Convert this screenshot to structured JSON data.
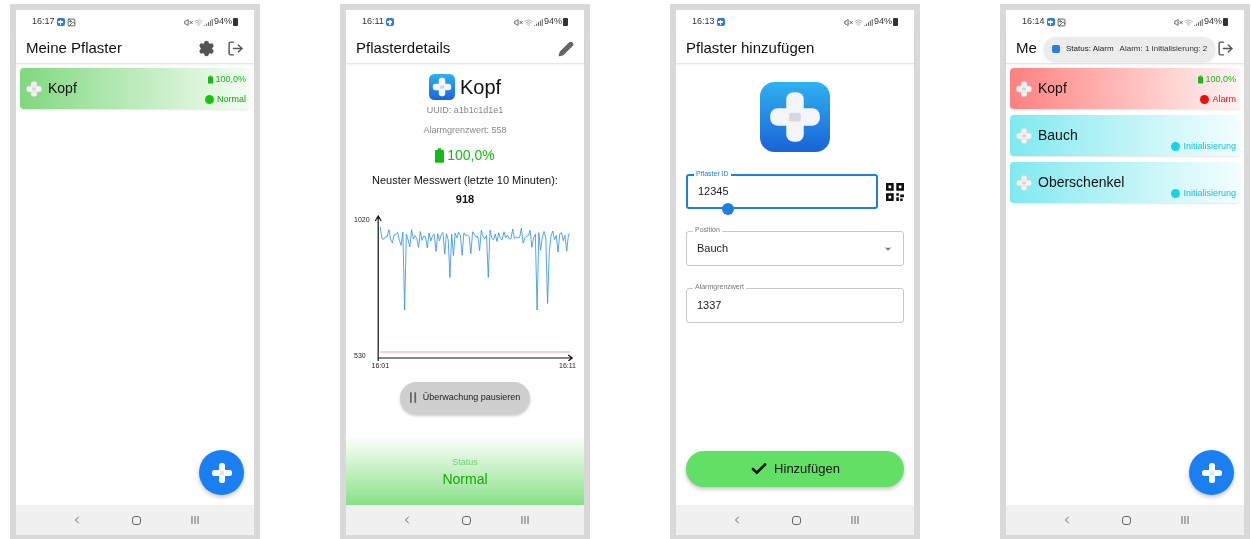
{
  "screens": [
    {
      "kind": "list",
      "status_bar": {
        "time": "16:17",
        "app_notification": true,
        "image_notification": true,
        "battery": "94%"
      },
      "title": "Meine Pflaster",
      "actions": {
        "settings": true,
        "logout": true
      },
      "fab": true,
      "patches": [
        {
          "name": "Kopf",
          "kind": "normal",
          "battery": "100,0%",
          "status": "Normal",
          "color": "#16c60c"
        }
      ]
    },
    {
      "kind": "details",
      "status_bar": {
        "time": "16:11",
        "app_notification": true,
        "battery": "94%"
      },
      "title": "Pflasterdetails",
      "actions": {
        "edit": true
      },
      "name": "Kopf",
      "uuid": "UUID: a1b1c1d1e1",
      "threshold": "Alarmgrenzwert: 558",
      "battery": "100,0%",
      "reading_label": "Neuster Messwert (letzte 10 Minuten):",
      "reading": "918",
      "chart": {
        "y_max": "1020",
        "y_min": "530",
        "x_start": "16:01",
        "x_end": "16:11"
      },
      "pause_button": "Überwachung pausieren",
      "status": {
        "kind": "normal",
        "label": "Status",
        "value": "Normal"
      }
    },
    {
      "kind": "add",
      "status_bar": {
        "time": "16:13",
        "app_notification": true,
        "battery": "94%"
      },
      "title": "Pflaster hinzufügen",
      "fields": [
        {
          "kind": "text",
          "label": "Pflaster ID",
          "value": "12345",
          "focused": true,
          "qr_button": true
        },
        {
          "kind": "select",
          "label": "Position",
          "value": "Bauch",
          "focused": false,
          "qr_button": false
        },
        {
          "kind": "text",
          "label": "Alarmgrenzwert",
          "value": "1337",
          "focused": false,
          "qr_button": false
        }
      ],
      "submit": "Hinzufügen"
    },
    {
      "kind": "list",
      "status_bar": {
        "time": "16:14",
        "app_notification": true,
        "image_notification": true,
        "battery": "94%"
      },
      "title": "Me",
      "actions": {
        "logout": true
      },
      "fab": true,
      "toast": {
        "title": "Status: Alarm",
        "text": "Alarm: 1 Initialisierung: 2"
      },
      "patches": [
        {
          "name": "Kopf",
          "kind": "alarm",
          "battery": "100,0%",
          "status": "Alarm",
          "color": "#e81010"
        },
        {
          "name": "Bauch",
          "kind": "init",
          "status": "Initialisierung",
          "color": "#17d3e6"
        },
        {
          "name": "Oberschenkel",
          "kind": "init",
          "status": "Initialisierung",
          "color": "#17d3e6"
        }
      ]
    }
  ]
}
